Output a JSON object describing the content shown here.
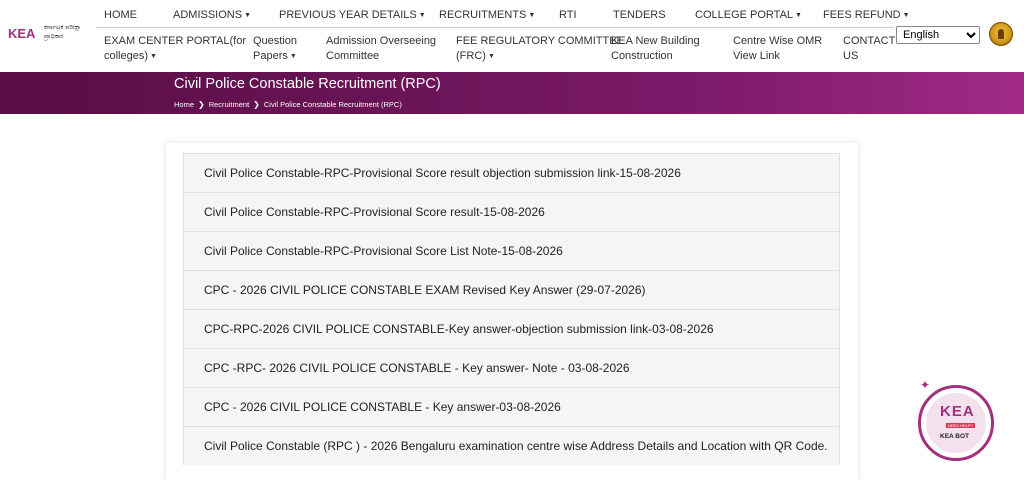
{
  "logo": {
    "letters": "KEA",
    "kannada_line1": "ಕರ್ನಾಟಕ ಪರೀಕ್ಷಾ",
    "kannada_line2": "ಪ್ರಾಧಿಕಾರ"
  },
  "nav_top": [
    {
      "label": "HOME",
      "caret": false
    },
    {
      "label": "ADMISSIONS",
      "caret": true
    },
    {
      "label": "PREVIOUS YEAR DETAILS",
      "caret": true
    },
    {
      "label": "RECRUITMENTS",
      "caret": true
    },
    {
      "label": "RTI",
      "caret": false
    },
    {
      "label": "TENDERS",
      "caret": false
    },
    {
      "label": "COLLEGE PORTAL",
      "caret": true
    },
    {
      "label": "FEES REFUND",
      "caret": true
    }
  ],
  "nav_bottom": [
    {
      "line1": "EXAM CENTER PORTAL(for",
      "line2": "colleges)",
      "caret": true
    },
    {
      "line1": "Question",
      "line2": "Papers",
      "caret": true
    },
    {
      "line1": "Admission Overseeing",
      "line2": "Committee",
      "caret": false
    },
    {
      "line1": "FEE REGULATORY COMMITTEE",
      "line2": "(FRC)",
      "caret": true
    },
    {
      "line1": "KEA New Building",
      "line2": "Construction",
      "caret": false
    },
    {
      "line1": "Centre Wise OMR",
      "line2": "View Link",
      "caret": false
    },
    {
      "line1": "CONTACT",
      "line2": "US",
      "caret": false
    }
  ],
  "caret_glyph": "▼",
  "language": {
    "selected": "English"
  },
  "banner": {
    "title": "Civil Police Constable Recruitment (RPC)",
    "breadcrumb": [
      "Home",
      "Recruitment",
      "Civil Police Constable Recruitment (RPC)"
    ],
    "separator": "❯"
  },
  "items": [
    "Civil Police Constable-RPC-Provisional Score result objection submission link-15-08-2026",
    "Civil Police Constable-RPC-Provisional Score result-15-08-2026",
    "Civil Police Constable-RPC-Provisional Score List Note-15-08-2026",
    "CPC - 2026 CIVIL POLICE CONSTABLE EXAM Revised Key Answer (29-07-2026)",
    "CPC-RPC-2026 CIVIL POLICE CONSTABLE-Key answer-objection submission link-03-08-2026",
    "CPC -RPC- 2026 CIVIL POLICE CONSTABLE - Key answer- Note - 03-08-2026",
    "CPC - 2026 CIVIL POLICE CONSTABLE - Key answer-03-08-2026",
    "Civil Police Constable (RPC ) - 2026 Bengaluru examination centre wise Address Details and Location with QR Code."
  ],
  "bot": {
    "letters": "KEA",
    "need_help": "NEED HELP?",
    "label": "KEA BOT"
  },
  "colors": {
    "brand": "#a3307c",
    "banner": "#6a1457"
  }
}
